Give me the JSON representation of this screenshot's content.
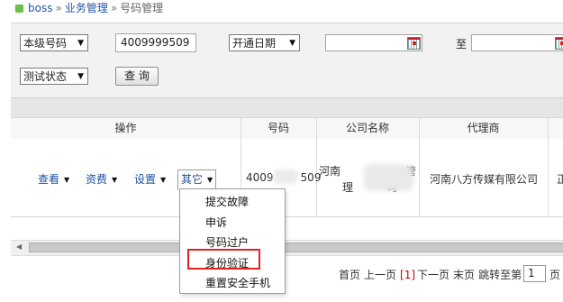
{
  "breadcrumb": {
    "root": "boss",
    "separator": "»",
    "section": "业务管理",
    "current": "号码管理"
  },
  "search": {
    "field_select": "本级号码",
    "number_value": "4009999509",
    "date_select": "开通日期",
    "to_label": "至",
    "status_select": "测试状态",
    "query_button": "查 询"
  },
  "table": {
    "headers": {
      "operation": "操作",
      "number": "号码",
      "company": "公司名称",
      "agent": "代理商"
    },
    "row": {
      "actions": {
        "view": "查看",
        "fee": "资费",
        "settings": "设置",
        "other": "其它"
      },
      "number_a": "4009",
      "number_b": "509",
      "company_line1_a": "河南",
      "company_line1_b": "管",
      "company_line2": "理",
      "company_line2_b": "司",
      "agent": "河南八方传媒有限公司",
      "last_col": "正"
    }
  },
  "menu": {
    "items": [
      "提交故障",
      "申诉",
      "号码过户",
      "身份验证",
      "重置安全手机"
    ],
    "highlighted": "身份验证"
  },
  "pager": {
    "first": "首页",
    "prev": "上一页",
    "current": "[1]",
    "next": "下一页",
    "last": "末页",
    "jump": "跳转至第",
    "page_value": "1",
    "unit": "页"
  },
  "colors": {
    "link": "#1d4fa0",
    "highlight_box": "#e02323",
    "breadcrumb_dot": "#6cc04a"
  }
}
